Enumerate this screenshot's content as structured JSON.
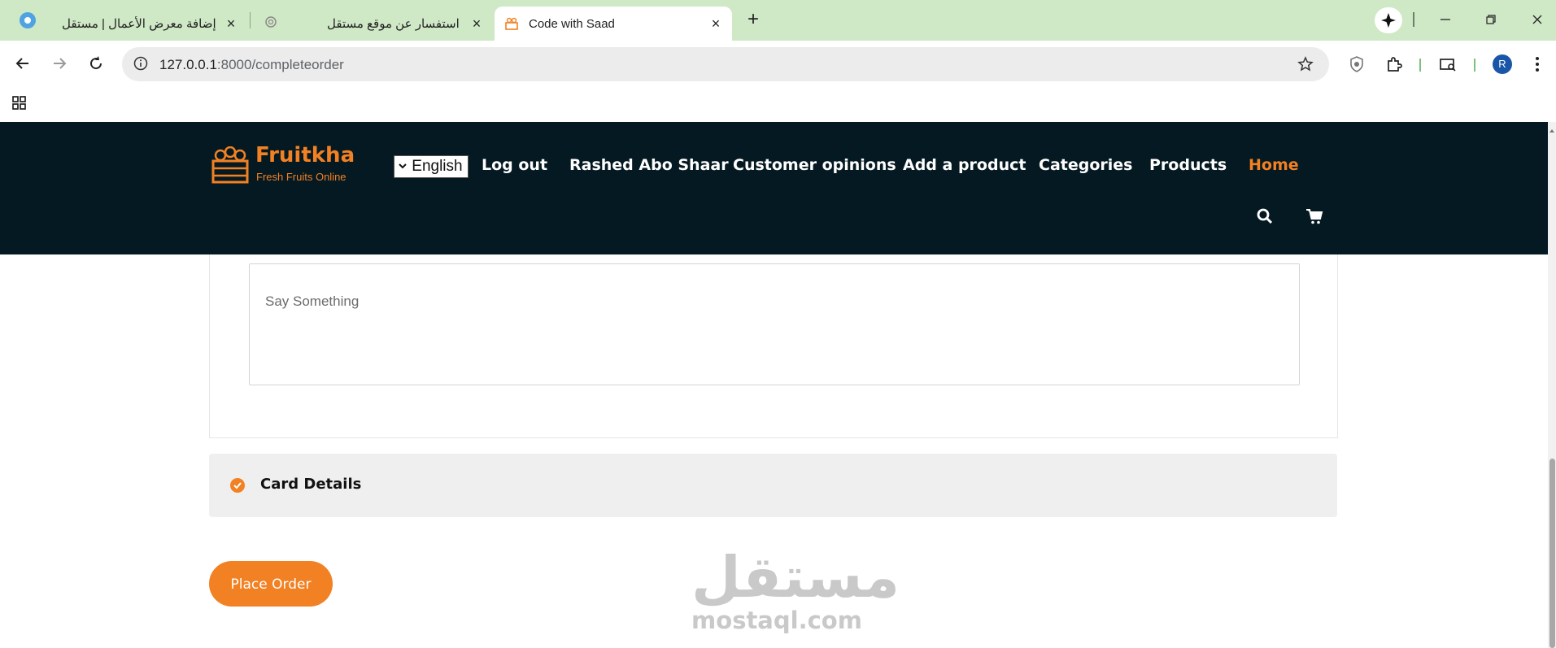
{
  "browser": {
    "tabs": [
      {
        "title": "إضافة معرض الأعمال | مستقل",
        "close": "×"
      },
      {
        "title": "استفسار عن موقع مستقل",
        "close": "×"
      },
      {
        "title": "Code with Saad",
        "close": "×"
      }
    ],
    "new_tab": "+",
    "address": {
      "host": "127.0.0.1",
      "path": ":8000/completeorder"
    },
    "profile_initial": "R",
    "colors": {
      "tabstrip": "#cfe8c5",
      "profile": "#1a56a8"
    }
  },
  "site": {
    "logo": {
      "name": "Fruitkha",
      "tagline": "Fresh Fruits Online"
    },
    "language": "English",
    "nav": {
      "logout": "Log out",
      "user": "Rashed Abo Shaar",
      "opinions": "Customer opinions",
      "add_product": "Add a product",
      "categories": "Categories",
      "products": "Products",
      "home": "Home"
    },
    "colors": {
      "accent": "#f28123",
      "header_bg": "#051922"
    }
  },
  "form": {
    "message_placeholder": "Say Something"
  },
  "card_details": {
    "title": "Card Details"
  },
  "actions": {
    "place_order": "Place Order"
  },
  "watermark": {
    "arabic": "مستقل",
    "latin": "mostaql.com"
  }
}
